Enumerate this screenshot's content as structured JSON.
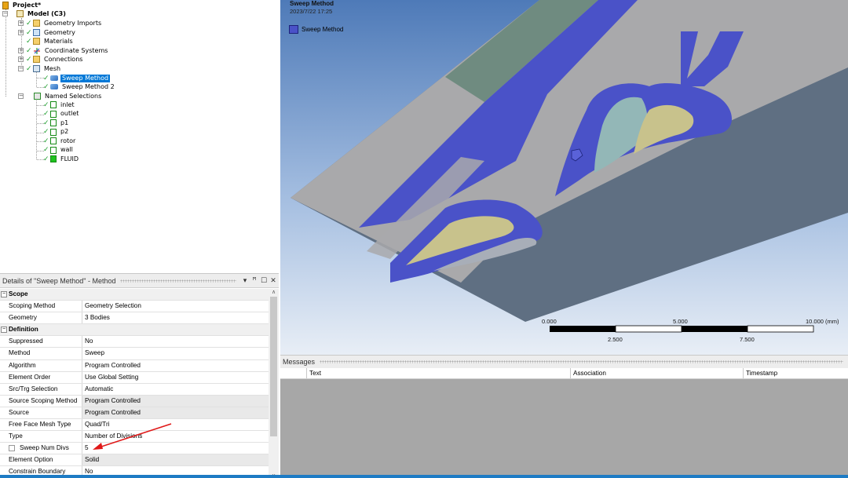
{
  "tree": {
    "project": "Project*",
    "model": "Model (C3)",
    "items": [
      {
        "label": "Geometry Imports"
      },
      {
        "label": "Geometry"
      },
      {
        "label": "Materials"
      },
      {
        "label": "Coordinate Systems"
      },
      {
        "label": "Connections"
      },
      {
        "label": "Mesh"
      }
    ],
    "mesh_children": [
      {
        "label": "Sweep Method",
        "selected": true
      },
      {
        "label": "Sweep Method 2"
      }
    ],
    "named_selections": {
      "label": "Named Selections",
      "items": [
        "inlet",
        "outlet",
        "p1",
        "p2",
        "rotor",
        "wall",
        "FLUID"
      ]
    }
  },
  "details": {
    "title": "Details of \"Sweep Method\" - Method",
    "header_icons": [
      "pin-icon",
      "restore-icon",
      "close-icon"
    ],
    "sections": [
      {
        "name": "Scope",
        "rows": [
          {
            "key": "Scoping Method",
            "value": "Geometry Selection"
          },
          {
            "key": "Geometry",
            "value": "3 Bodies"
          }
        ]
      },
      {
        "name": "Definition",
        "rows": [
          {
            "key": "Suppressed",
            "value": "No"
          },
          {
            "key": "Method",
            "value": "Sweep"
          },
          {
            "key": "Algorithm",
            "value": "Program Controlled"
          },
          {
            "key": "Element Order",
            "value": "Use Global Setting"
          },
          {
            "key": "Src/Trg Selection",
            "value": "Automatic"
          },
          {
            "key": "Source Scoping Method",
            "value": "Program Controlled"
          },
          {
            "key": "Source",
            "value": "Program Controlled"
          },
          {
            "key": "Free Face Mesh Type",
            "value": "Quad/Tri"
          },
          {
            "key": "Type",
            "value": "Number of Divisions"
          },
          {
            "key": "Sweep Num Divs",
            "value": "5"
          },
          {
            "key": "Element Option",
            "value": "Solid"
          },
          {
            "key": "Constrain Boundary",
            "value": "No"
          }
        ]
      }
    ]
  },
  "viewport": {
    "title": "Sweep Method",
    "date": "2023/7/22 17:25",
    "legend": "Sweep Method",
    "legend_color": "#4a52c8",
    "scale": {
      "labels_top": [
        "0.000",
        "5.000",
        "10.000 (mm)"
      ],
      "labels_bottom": [
        "2.500",
        "7.500"
      ]
    }
  },
  "messages": {
    "title": "Messages",
    "columns": [
      "Text",
      "Association",
      "Timestamp"
    ]
  },
  "colors": {
    "accent": "#0078d7",
    "sweep_body": "#4a52c8",
    "annotation_arrow": "#e01818"
  }
}
